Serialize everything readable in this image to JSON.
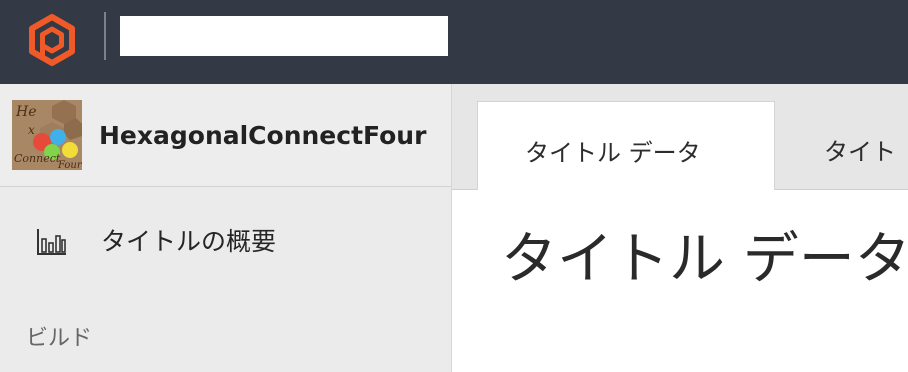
{
  "topbar": {
    "logo_icon": "hexagon-logo-icon",
    "brand_color": "#f05a28",
    "background": "#333a45",
    "title_text": ""
  },
  "sidebar": {
    "game_title": "HexagonalConnectFour",
    "thumbnail_text": "Hex Connect Four",
    "items": [
      {
        "icon": "bar-chart-icon",
        "label": "タイトルの概要"
      }
    ],
    "section_label": "ビルド"
  },
  "tabs": [
    {
      "label": "タイトル データ",
      "active": true
    },
    {
      "label": "タイト",
      "active": false
    }
  ],
  "main": {
    "heading": "タイトル データ"
  }
}
